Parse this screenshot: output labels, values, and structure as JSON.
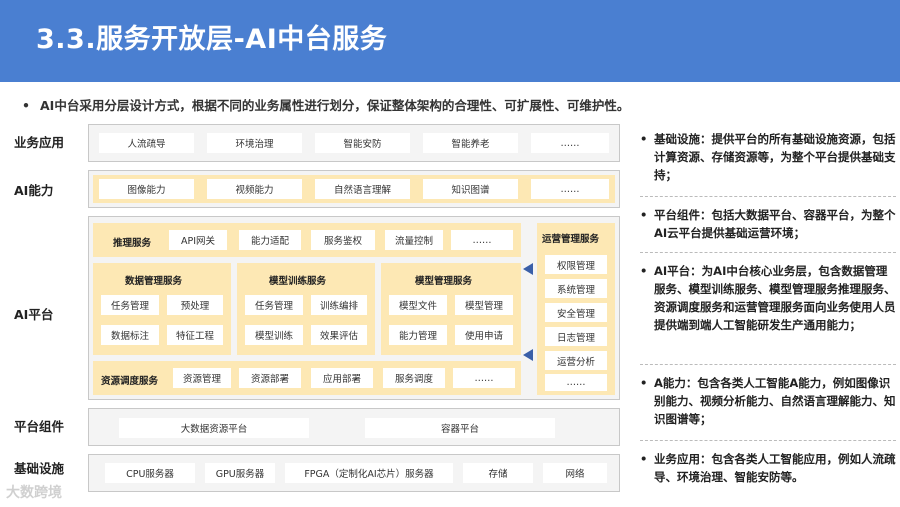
{
  "header": {
    "title": "3.3.服务开放层-AI中台服务"
  },
  "intro": {
    "bullet": "•",
    "text": "AI中台采用分层设计方式，根据不同的业务属性进行划分，保证整体架构的合理性、可扩展性、可维护性。"
  },
  "layers": {
    "business_app": {
      "label": "业务应用",
      "items": [
        "人流疏导",
        "环境治理",
        "智能安防",
        "智能养老",
        "……"
      ]
    },
    "ai_capability": {
      "label": "AI能力",
      "items": [
        "图像能力",
        "视频能力",
        "自然语言理解",
        "知识图谱",
        "……"
      ]
    },
    "ai_platform": {
      "label": "AI平台",
      "inference": {
        "label": "推理服务",
        "items": [
          "API网关",
          "能力适配",
          "服务鉴权",
          "流量控制",
          "……"
        ]
      },
      "data_mgmt": {
        "label": "数据管理服务",
        "items": [
          "任务管理",
          "预处理",
          "数据标注",
          "特征工程"
        ]
      },
      "model_train": {
        "label": "模型训练服务",
        "items": [
          "任务管理",
          "训练编排",
          "模型训练",
          "效果评估"
        ]
      },
      "model_mgmt": {
        "label": "模型管理服务",
        "items": [
          "模型文件",
          "模型管理",
          "能力管理",
          "使用申请"
        ]
      },
      "resource_sched": {
        "label": "资源调度服务",
        "items": [
          "资源管理",
          "资源部署",
          "应用部署",
          "服务调度",
          "……"
        ]
      },
      "ops": {
        "label": "运营管理服务",
        "items": [
          "权限管理",
          "系统管理",
          "安全管理",
          "日志管理",
          "运营分析",
          "……"
        ]
      }
    },
    "platform_components": {
      "label": "平台组件",
      "items": [
        "大数据资源平台",
        "容器平台"
      ]
    },
    "infrastructure": {
      "label": "基础设施",
      "items": [
        "CPU服务器",
        "GPU服务器",
        "FPGA（定制化AI芯片）服务器",
        "存储",
        "网络"
      ]
    }
  },
  "bullets": [
    {
      "dot": "•",
      "text": "基础设施：提供平台的所有基础设施资源，包括计算资源、存储资源等，为整个平台提供基础支持；"
    },
    {
      "dot": "•",
      "text": "平台组件：包括大数据平台、容器平台，为整个AI云平台提供基础运营环境；"
    },
    {
      "dot": "•",
      "text": "AI平台：为AI中台核心业务层，包含数据管理服务、模型训练服务、模型管理服务推理服务、资源调度服务和运营管理服务面向业务使用人员提供端到端人工智能研发生产通用能力；"
    },
    {
      "dot": "•",
      "text": "A能力：包含各类人工智能A能力，例如图像识别能力、视频分析能力、自然语言理解能力、知识图谱等；"
    },
    {
      "dot": "•",
      "text": "业务应用：包含各类人工智能应用，例如人流疏导、环境治理、智能安防等。"
    }
  ],
  "watermark": "大数跨境",
  "colors": {
    "header": "#4a7fd1",
    "yellow": "#fde8b4",
    "arrow": "#3a5fa8"
  }
}
